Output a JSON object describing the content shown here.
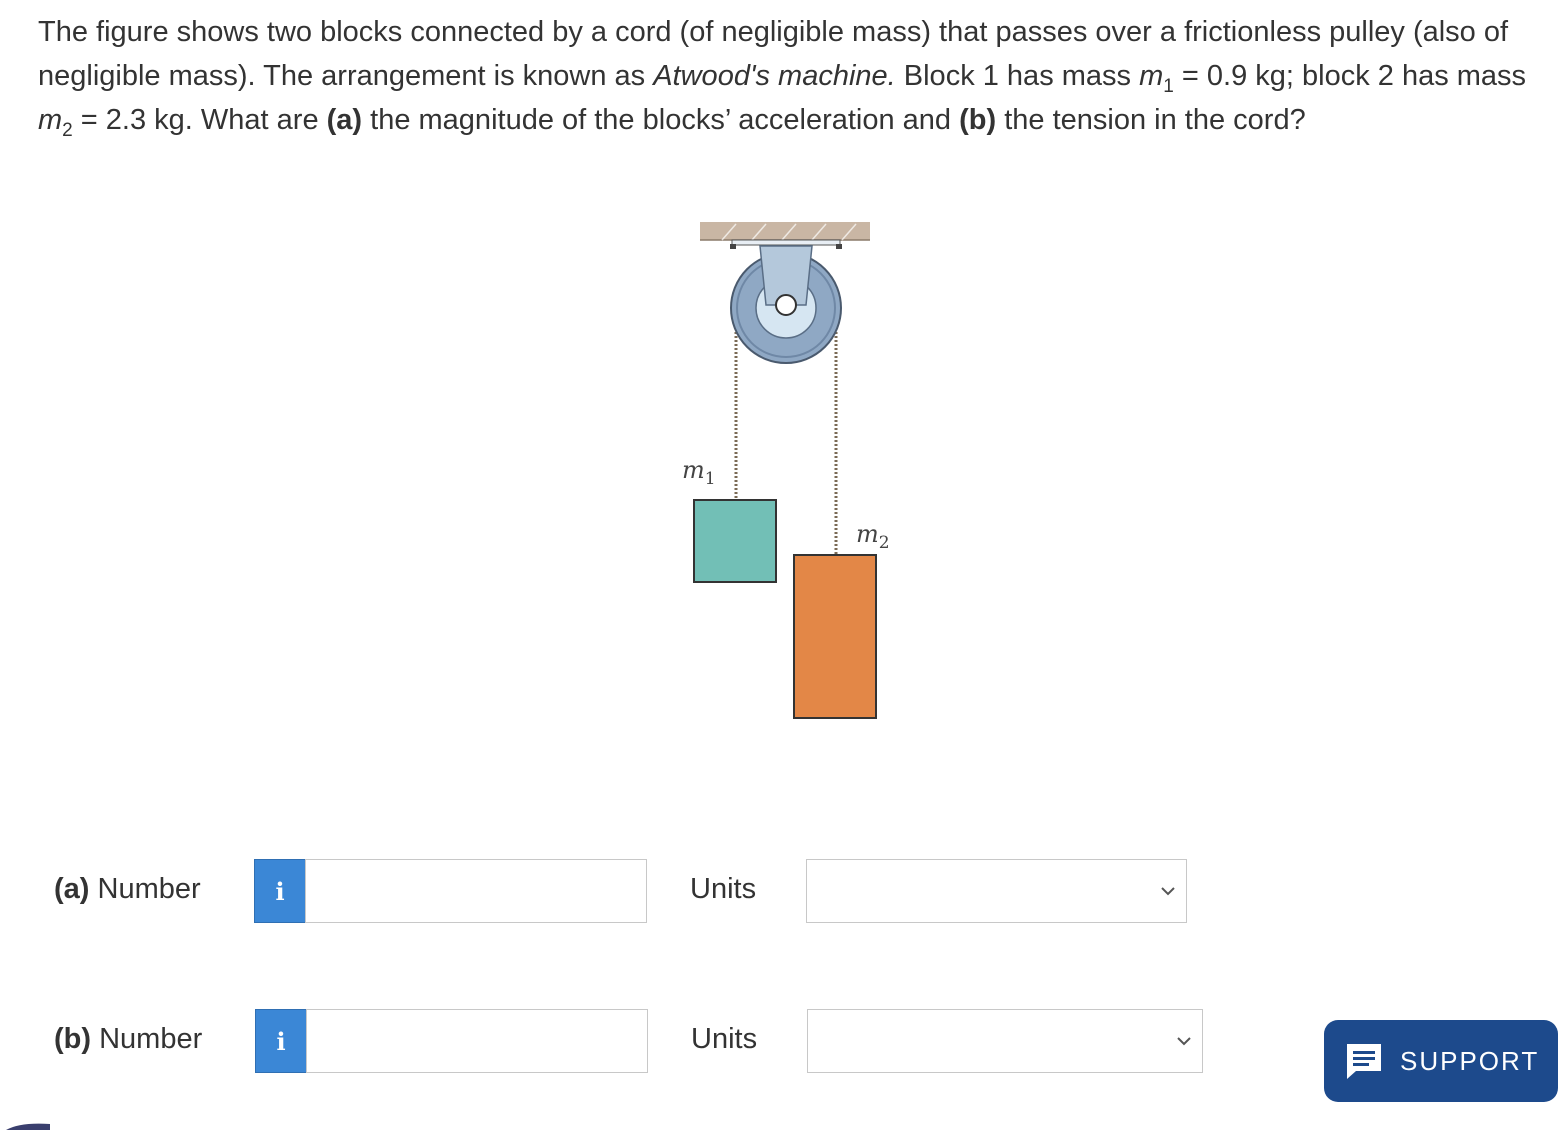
{
  "question": {
    "part1": "The figure shows two blocks connected by a cord (of negligible mass) that passes over a frictionless pulley (also of negligible mass). The arrangement is known as ",
    "machine_name": "Atwood's machine.",
    "part2": " Block 1 has mass ",
    "m1_symbol": "m",
    "m1_sub": "1",
    "m1_value": " = 0.9 kg; block 2 has mass ",
    "m2_symbol": "m",
    "m2_sub": "2",
    "m2_value": " = 2.3 kg. What are ",
    "a_tag": "(a)",
    "a_text": " the magnitude of the blocks’ acceleration and ",
    "b_tag": "(b)",
    "b_text": " the tension in the cord?"
  },
  "figure": {
    "label_m1": "m",
    "label_m1_sub": "1",
    "label_m2": "m",
    "label_m2_sub": "2",
    "colors": {
      "ceiling": "#c9b6a4",
      "pulley_outer": "#8fa8c4",
      "pulley_inner": "#d6e6f2",
      "block1": "#72bfb6",
      "block2": "#e38747"
    }
  },
  "answers": {
    "a": {
      "tag": "(a)",
      "label": " Number",
      "info_icon": "i",
      "value": "",
      "units_label": "Units",
      "units_selected": ""
    },
    "b": {
      "tag": "(b)",
      "label": " Number",
      "info_icon": "i",
      "value": "",
      "units_label": "Units",
      "units_selected": ""
    }
  },
  "support": {
    "label": "SUPPORT",
    "icon": "chat-lines-icon",
    "color": "#1d4a8c"
  },
  "accent": "#3b87d6"
}
